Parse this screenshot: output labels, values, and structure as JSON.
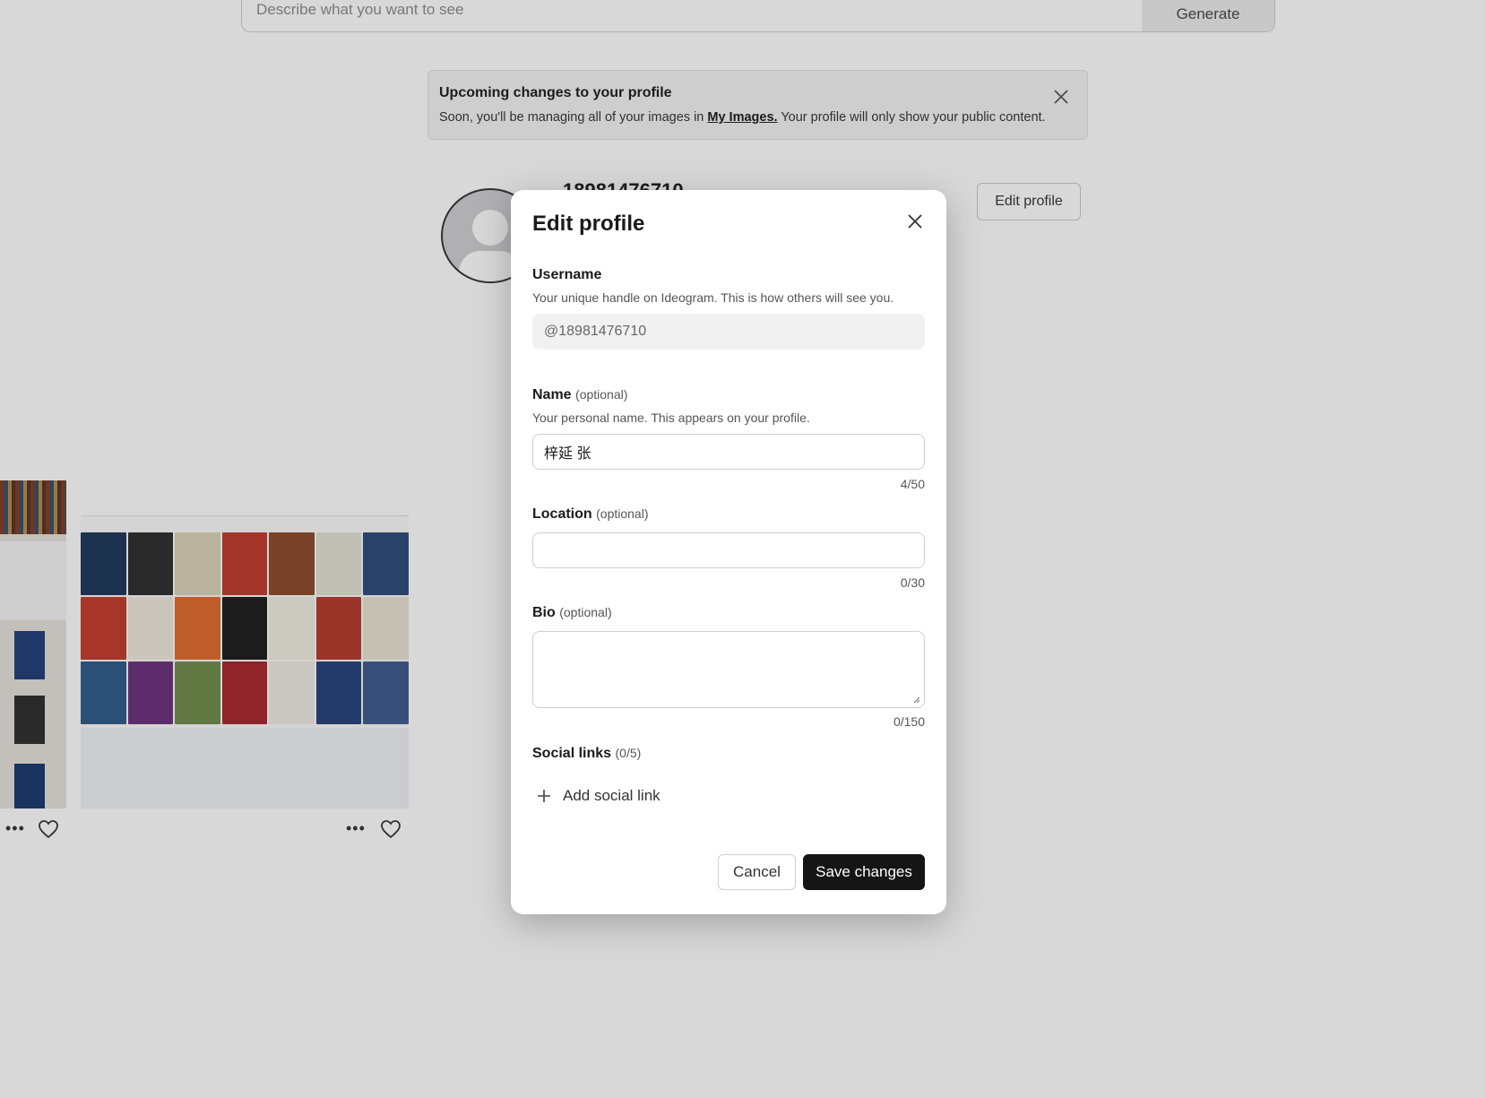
{
  "generate_bar": {
    "placeholder": "Describe what you want to see",
    "button_label": "Generate"
  },
  "notice": {
    "title": "Upcoming changes to your profile",
    "text_before": "Soon, you'll be managing all of your images in ",
    "link_label": "My Images.",
    "text_after": " Your profile will only show your public content."
  },
  "profile": {
    "handle_partial": "18981476710",
    "edit_button_label": "Edit profile"
  },
  "cards": {
    "more_label": "•••"
  },
  "modal": {
    "title": "Edit profile",
    "username": {
      "label": "Username",
      "help": "Your unique handle on Ideogram. This is how others will see you.",
      "value": "@18981476710"
    },
    "name": {
      "label": "Name",
      "optional": "(optional)",
      "help": "Your personal name. This appears on your profile.",
      "value": "梓延 张",
      "counter": "4/50"
    },
    "location": {
      "label": "Location",
      "optional": "(optional)",
      "value": "",
      "counter": "0/30"
    },
    "bio": {
      "label": "Bio",
      "optional": "(optional)",
      "value": "",
      "counter": "0/150"
    },
    "social": {
      "label": "Social links",
      "count": "(0/5)",
      "add_label": "Add social link"
    },
    "cancel_label": "Cancel",
    "save_label": "Save changes"
  }
}
